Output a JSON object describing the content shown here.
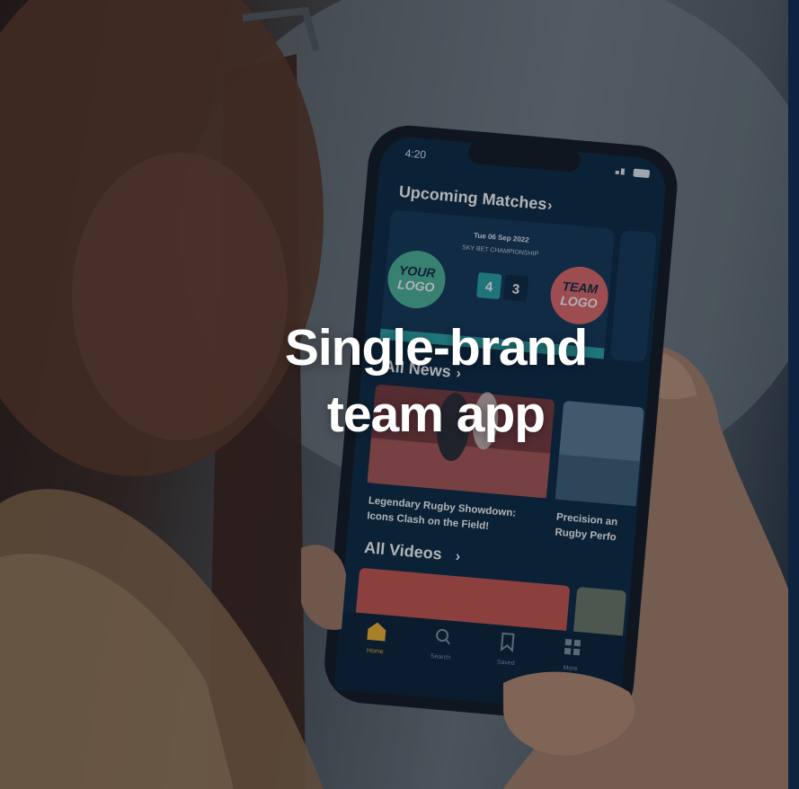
{
  "headline": {
    "line1": "Single-brand",
    "line2": "team app"
  },
  "phone": {
    "status_time": "4:20",
    "section_upcoming": "Upcoming Matches",
    "match_date": "Tue 06 Sep 2022",
    "match_competition": "SKY BET CHAMPIONSHIP",
    "home_logo_line1": "YOUR",
    "home_logo_line2": "LOGO",
    "away_logo_line1": "TEAM",
    "away_logo_line2": "LOGO",
    "home_score": "4",
    "away_score": "3",
    "section_news": "All News",
    "news1_line1": "Legendary Rugby Showdown:",
    "news1_line2": "Icons Clash on the Field!",
    "news2_line1": "Precision an",
    "news2_line2": "Rugby Perfo",
    "section_videos": "All Videos",
    "nav_home": "Home",
    "nav_search": "Search",
    "nav_saved": "Saved",
    "nav_more": "More"
  },
  "colors": {
    "app_bg": "#0d2a45",
    "accent_teal": "#2aa6a6",
    "home_logo": "#4fb59a",
    "away_logo": "#e46a6a",
    "nav_active": "#f2b632"
  }
}
